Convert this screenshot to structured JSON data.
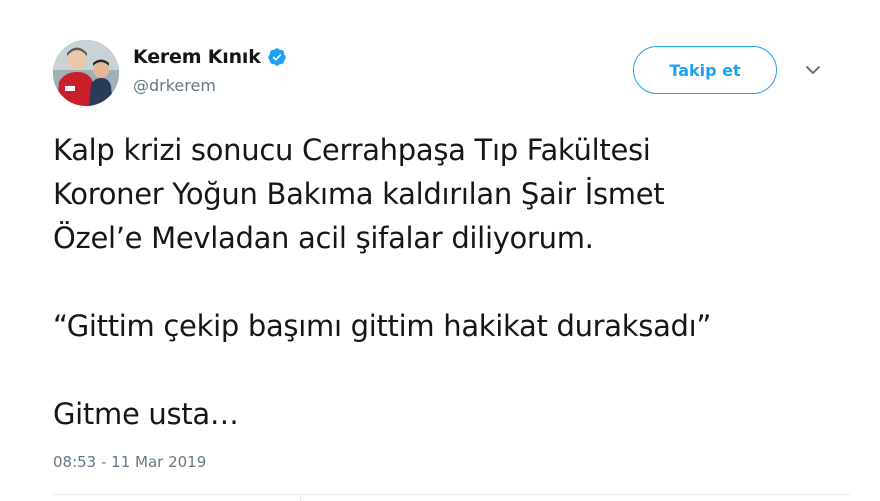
{
  "user": {
    "display_name": "Kerem Kınık",
    "handle": "@drkerem",
    "verified": true
  },
  "header": {
    "follow_label": "Takip et"
  },
  "tweet": {
    "lines": [
      "Kalp krizi sonucu Cerrahpaşa Tıp Fakültesi",
      "Koroner Yoğun Bakıma kaldırılan Şair İsmet",
      "Özel’e Mevladan acil şifalar diliyorum.",
      "“Gittim çekip başımı gittim hakikat duraksadı”",
      "Gitme usta…"
    ],
    "timestamp": "08:53 - 11 Mar 2019"
  },
  "icons": {
    "verified": "verified-badge-icon",
    "more": "chevron-down-icon"
  },
  "colors": {
    "accent": "#1da1f2",
    "text": "#14171a",
    "secondary": "#657786"
  }
}
